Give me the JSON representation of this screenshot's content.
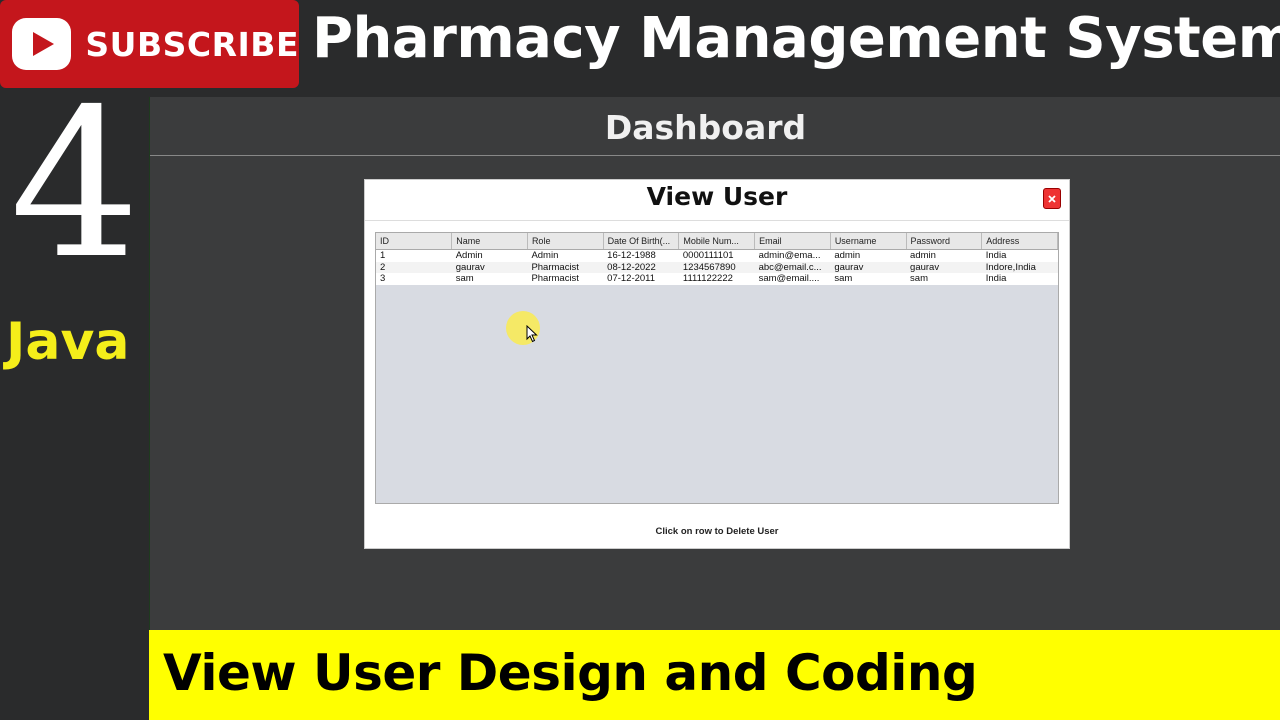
{
  "channel": {
    "subscribe_label": "SUBSCRIBE",
    "subscribe_color": "#c4161c",
    "logo_icon": "play-icon"
  },
  "video": {
    "title": "Pharmacy Management System",
    "episode_number": "4",
    "language": "Java",
    "topic": "View User Design and Coding",
    "topic_banner_color": "#ffff00",
    "language_color": "#f5ee1a"
  },
  "app": {
    "header_title": "Dashboard",
    "dialog": {
      "title": "View User",
      "close_icon": "close-icon",
      "hint": "Click on row to Delete User",
      "table": {
        "columns": [
          "ID",
          "Name",
          "Role",
          "Date Of Birth(...",
          "Mobile Num...",
          "Email",
          "Username",
          "Password",
          "Address"
        ],
        "rows": [
          [
            "1",
            "Admin",
            "Admin",
            "16-12-1988",
            "0000111101",
            "admin@ema...",
            "admin",
            "admin",
            "India"
          ],
          [
            "2",
            "gaurav",
            "Pharmacist",
            "08-12-2022",
            "1234567890",
            "abc@email.c...",
            "gaurav",
            "gaurav",
            "Indore,India"
          ],
          [
            "3",
            "sam",
            "Pharmacist",
            "07-12-2011",
            "1111122222",
            "sam@email....",
            "sam",
            "sam",
            "India"
          ]
        ]
      }
    }
  }
}
